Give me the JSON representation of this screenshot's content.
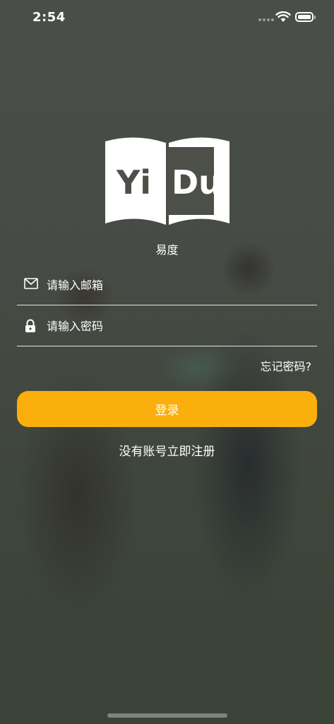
{
  "status_bar": {
    "time": "2:54"
  },
  "logo": {
    "text_left": "Yi",
    "text_right": "Du"
  },
  "app": {
    "name": "易度"
  },
  "form": {
    "email_placeholder": "请输入邮箱",
    "email_value": "",
    "password_placeholder": "请输入密码",
    "password_value": "",
    "forgot_label": "忘记密码?",
    "login_label": "登录",
    "register_label": "没有账号立即注册"
  },
  "colors": {
    "accent": "#fbaf0d",
    "text": "#ffffff"
  },
  "icons": {
    "email": "envelope-icon",
    "password": "lock-icon",
    "wifi": "wifi-icon",
    "battery": "battery-icon"
  }
}
